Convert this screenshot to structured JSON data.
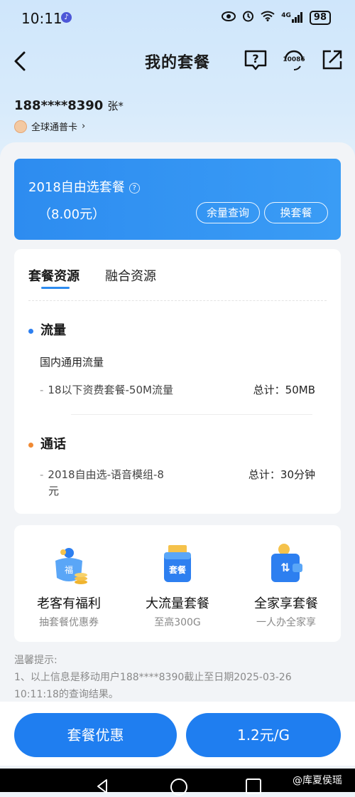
{
  "status_bar": {
    "time": "10:11",
    "signal_label": "4G",
    "battery": "98"
  },
  "header": {
    "title": "我的套餐",
    "service_label": "10086"
  },
  "user": {
    "phone": "188****8390",
    "name": "张*",
    "card_type": "全球通普卡"
  },
  "plan": {
    "name": "2018自由选套餐",
    "price": "（8.00元）",
    "query_button": "余量查询",
    "change_button": "换套餐"
  },
  "resources": {
    "tabs": [
      "套餐资源",
      "融合资源"
    ],
    "data_section": {
      "title": "流量",
      "subtitle": "国内通用流量",
      "items": [
        {
          "name": "18以下资费套餐-50M流量",
          "total": "总计：50MB"
        }
      ]
    },
    "call_section": {
      "title": "通话",
      "items": [
        {
          "name_line1": "2018自由选-语音模组-8",
          "name_line2": "元",
          "total": "总计：30分钟"
        }
      ]
    }
  },
  "promos": [
    {
      "title": "老客有福利",
      "subtitle": "抽套餐优惠券",
      "icon_text": "福"
    },
    {
      "title": "大流量套餐",
      "subtitle": "至高300G",
      "icon_text": "套餐"
    },
    {
      "title": "全家享套餐",
      "subtitle": "一人办全家享",
      "icon_text": "⇅"
    }
  ],
  "tips": {
    "title": "温馨提示:",
    "line1": "1、以上信息是移动用户188****8390截止至日期2025-03-26",
    "line2": "10:11:18的查询结果。"
  },
  "bottom_buttons": {
    "left": "套餐优惠",
    "right": "1.2元/G"
  },
  "watermark": "@库夏侯瑶",
  "colors": {
    "primary": "#2d8cf0",
    "data_dot": "#2d7ff0",
    "call_dot": "#f08a34"
  }
}
